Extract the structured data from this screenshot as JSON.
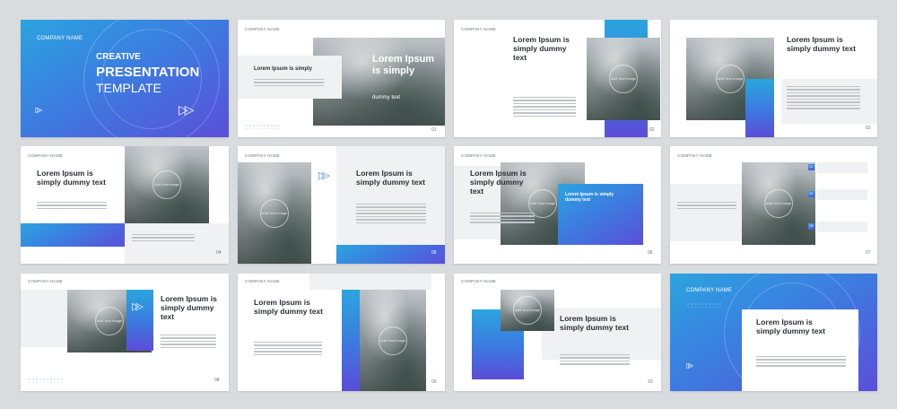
{
  "company": "COMPANY NAME",
  "cover": {
    "line1": "CREATIVE",
    "line2": "PRESENTATION",
    "line3": "TEMPLATE"
  },
  "heading_short": "Lorem Ipsum is simply",
  "heading_full": "Lorem Ipsum is simply dummy text",
  "sub": "dummy text",
  "image_label": "Add Your Image",
  "numbers": [
    "01",
    "02",
    "03",
    "04",
    "05",
    "06",
    "07",
    "08",
    "09",
    "10"
  ],
  "list_markers": [
    "01",
    "02",
    "03"
  ],
  "colors": {
    "blue": "#2ba4df",
    "violet": "#5a4fd9",
    "background": "#d9dcdf"
  }
}
